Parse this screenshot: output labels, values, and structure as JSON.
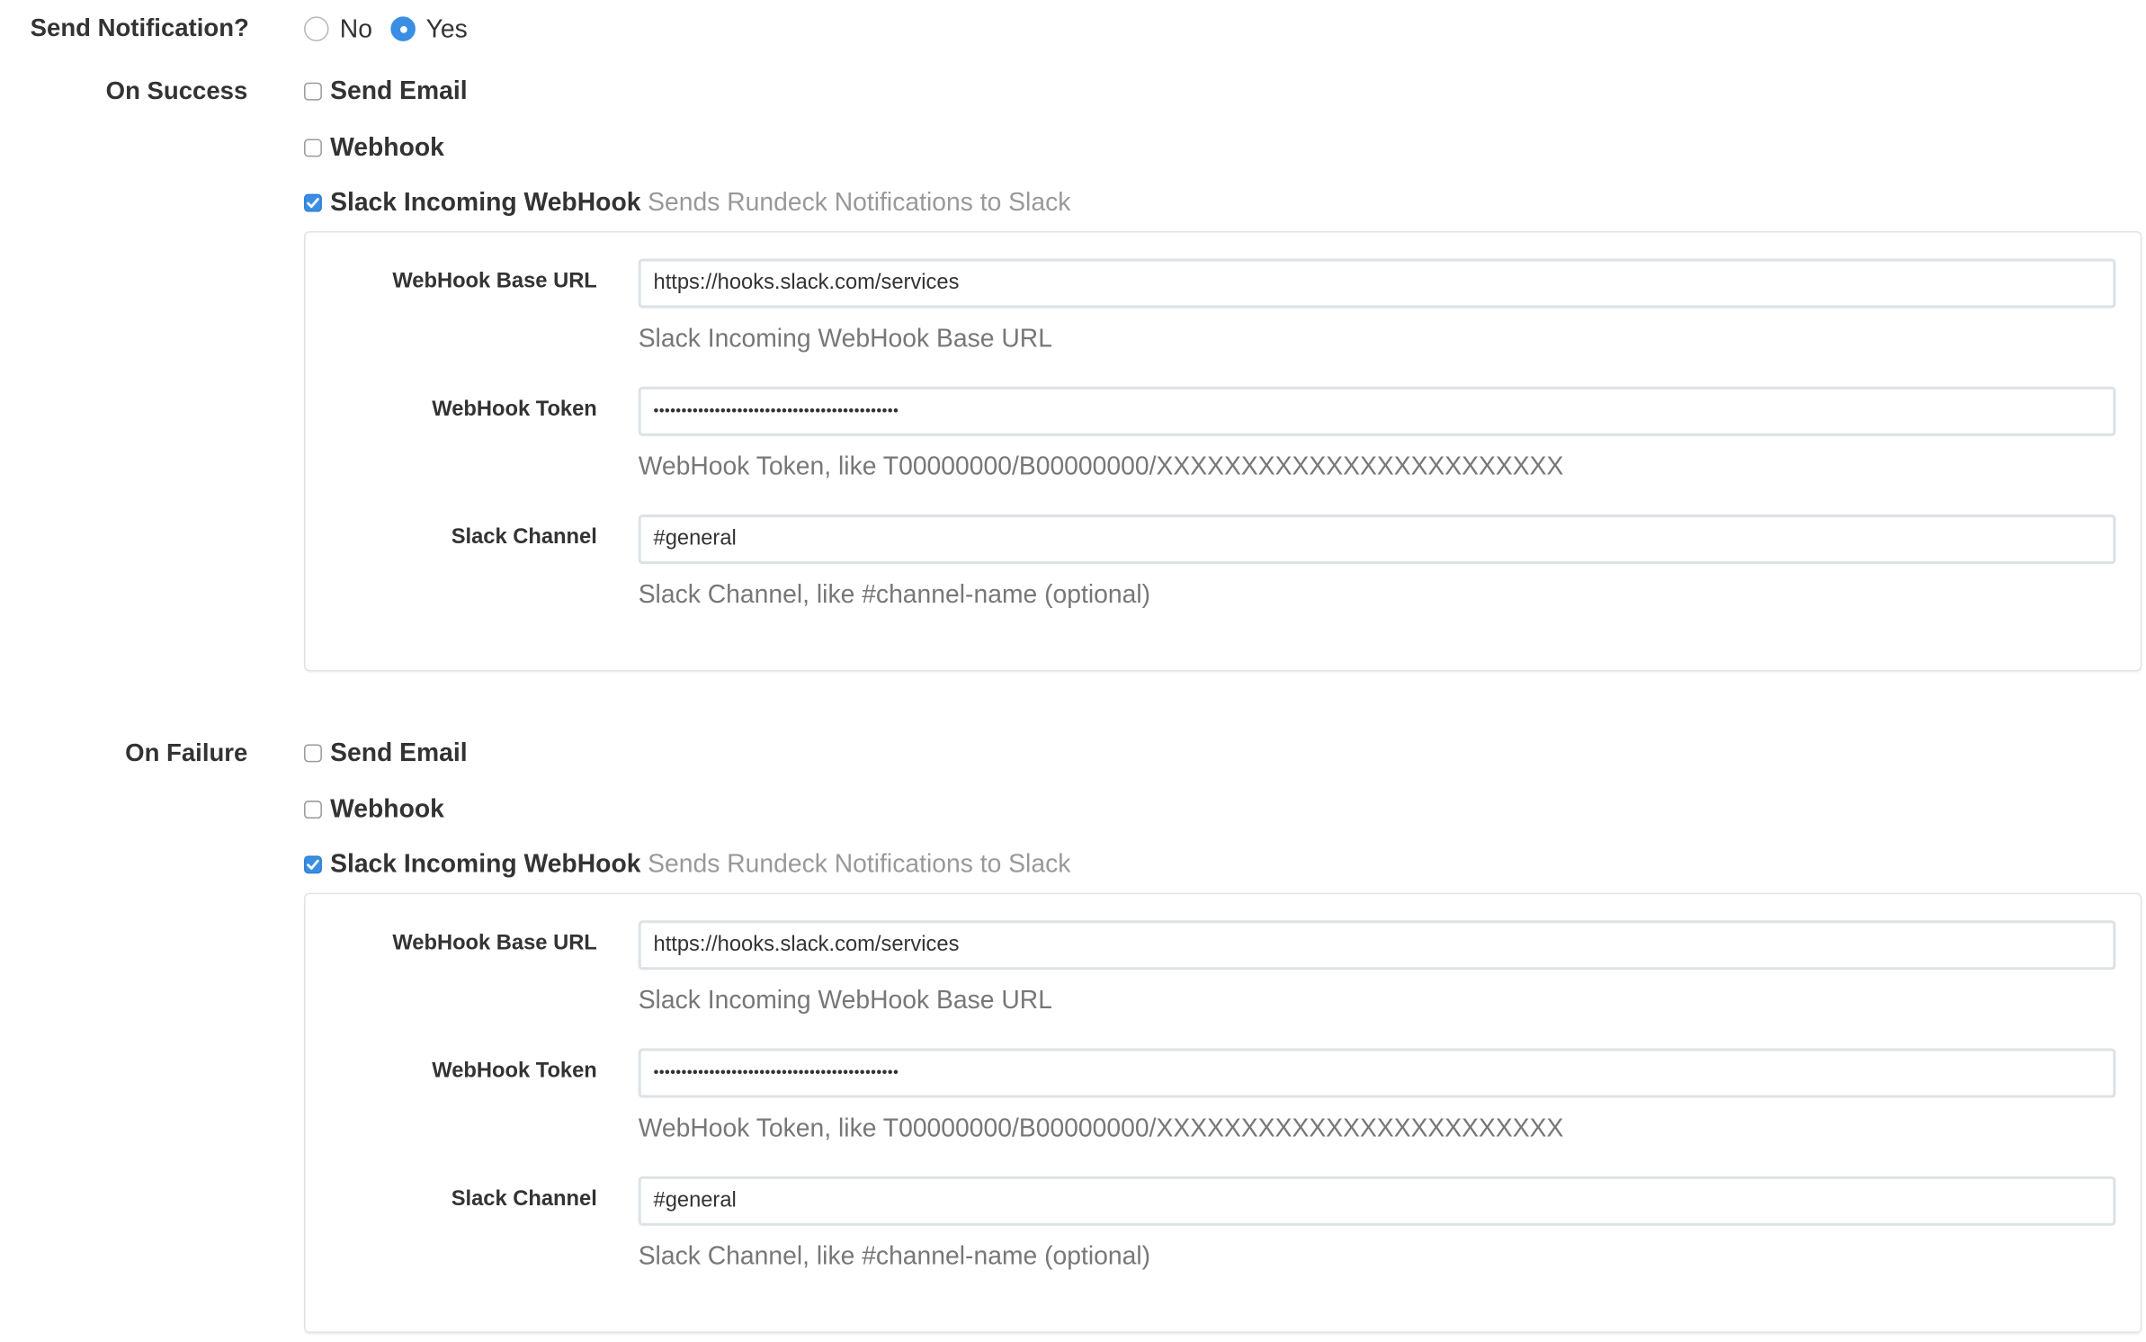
{
  "send_notification": {
    "label": "Send Notification?",
    "options": [
      {
        "label": "No",
        "selected": false
      },
      {
        "label": "Yes",
        "selected": true
      }
    ]
  },
  "sections": [
    {
      "label": "On Success",
      "options": [
        {
          "name": "Send Email",
          "checked": false
        },
        {
          "name": "Webhook",
          "checked": false
        },
        {
          "name": "Slack Incoming WebHook",
          "description": "Sends Rundeck Notifications to Slack",
          "checked": true
        }
      ],
      "fields": [
        {
          "label": "WebHook Base URL",
          "value": "https://hooks.slack.com/services",
          "help": "Slack Incoming WebHook Base URL"
        },
        {
          "label": "WebHook Token",
          "value": "••••••••••••••••••••••••••••••••••••••••••••",
          "help": "WebHook Token, like T00000000/B00000000/XXXXXXXXXXXXXXXXXXXXXXXX"
        },
        {
          "label": "Slack Channel",
          "value": "#general",
          "help": "Slack Channel, like #channel-name (optional)"
        }
      ]
    },
    {
      "label": "On Failure",
      "options": [
        {
          "name": "Send Email",
          "checked": false
        },
        {
          "name": "Webhook",
          "checked": false
        },
        {
          "name": "Slack Incoming WebHook",
          "description": "Sends Rundeck Notifications to Slack",
          "checked": true
        }
      ],
      "fields": [
        {
          "label": "WebHook Base URL",
          "value": "https://hooks.slack.com/services",
          "help": "Slack Incoming WebHook Base URL"
        },
        {
          "label": "WebHook Token",
          "value": "••••••••••••••••••••••••••••••••••••••••••••",
          "help": "WebHook Token, like T00000000/B00000000/XXXXXXXXXXXXXXXXXXXXXXXX"
        },
        {
          "label": "Slack Channel",
          "value": "#general",
          "help": "Slack Channel, like #channel-name (optional)"
        }
      ]
    }
  ],
  "colors": {
    "accent": "#3a8fe4",
    "help_text": "#777777",
    "muted": "#999999"
  }
}
